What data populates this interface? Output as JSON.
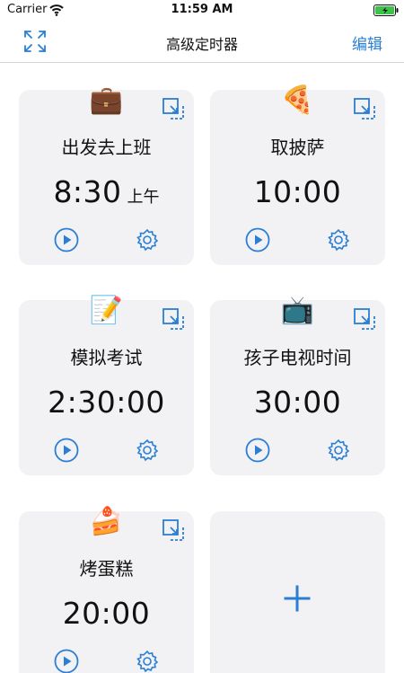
{
  "status": {
    "carrier": "Carrier",
    "time": "11:59 AM"
  },
  "nav": {
    "title": "高级定时器",
    "edit_label": "编辑"
  },
  "timers": [
    {
      "emoji": "💼",
      "name": "出发去上班",
      "time": "8:30",
      "suffix": "上午"
    },
    {
      "emoji": "🍕",
      "name": "取披萨",
      "time": "10:00",
      "suffix": ""
    },
    {
      "emoji": "📝",
      "name": "模拟考试",
      "time": "2:30:00",
      "suffix": ""
    },
    {
      "emoji": "📺",
      "name": "孩子电视时间",
      "time": "30:00",
      "suffix": ""
    },
    {
      "emoji": "🍰",
      "name": "烤蛋糕",
      "time": "20:00",
      "suffix": ""
    }
  ],
  "icons": {
    "expand": "expand-icon",
    "card_action": "open-in-window-icon",
    "play": "play-icon",
    "gear": "gear-icon",
    "add": "plus-icon"
  },
  "colors": {
    "accent": "#2a7fd4",
    "card_bg": "#f2f2f4"
  }
}
